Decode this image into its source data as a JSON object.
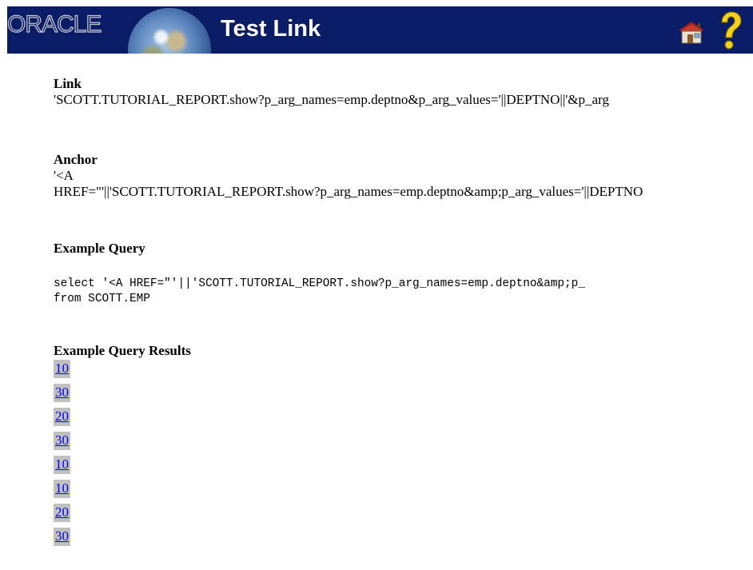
{
  "header": {
    "logo_text": "ORACLE",
    "title": "Test Link",
    "home_icon": "home-icon",
    "help_icon": "help-icon",
    "colors": {
      "banner": "#0b1c66",
      "title": "#ffffff",
      "help": "#f2d21b"
    }
  },
  "link": {
    "heading": "Link",
    "value": "'SCOTT.TUTORIAL_REPORT.show?p_arg_names=emp.deptno&p_arg_values='||DEPTNO||'&p_arg"
  },
  "anchor": {
    "heading": "Anchor",
    "line1": "'<A",
    "line2": "HREF=\"'||'SCOTT.TUTORIAL_REPORT.show?p_arg_names=emp.deptno&amp;p_arg_values='||DEPTNO"
  },
  "example_query": {
    "heading": "Example Query",
    "line1": "select '<A HREF=\"'||'SCOTT.TUTORIAL_REPORT.show?p_arg_names=emp.deptno&amp;p_",
    "line2": "from SCOTT.EMP"
  },
  "example_results": {
    "heading": "Example Query Results",
    "items": [
      "10",
      "30",
      "20",
      "30",
      "10",
      "10",
      "20",
      "30"
    ],
    "colors": {
      "link": "#0000ee",
      "highlight": "#c0c0c0"
    }
  }
}
